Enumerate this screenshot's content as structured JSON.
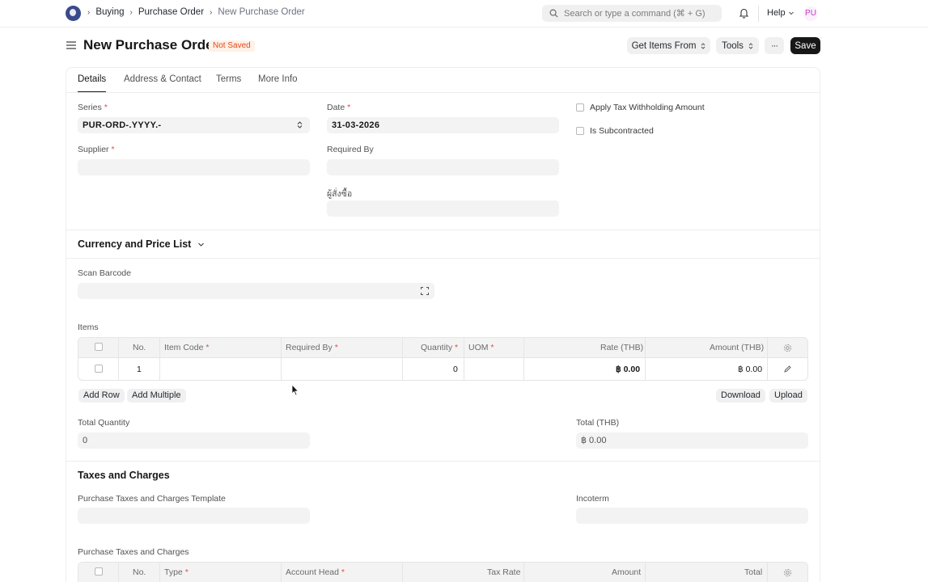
{
  "navbar": {
    "breadcrumbs": [
      "Buying",
      "Purchase Order",
      "New Purchase Order"
    ],
    "search_placeholder": "Search or type a command (⌘ + G)",
    "help_label": "Help",
    "avatar_initials": "PU"
  },
  "page": {
    "title": "New Purchase Order",
    "status": "Not Saved",
    "actions": {
      "get_items_from": "Get Items From",
      "tools": "Tools",
      "more": "···",
      "save": "Save"
    }
  },
  "tabs": [
    "Details",
    "Address & Contact",
    "Terms",
    "More Info"
  ],
  "details": {
    "series_label": "Series",
    "series_value": "PUR-ORD-.YYYY.-",
    "date_label": "Date",
    "date_value": "31-03-2026",
    "supplier_label": "Supplier",
    "required_by_label": "Required By",
    "buyer_label": "ผู้สั่งซื้อ",
    "apply_tax_withholding_label": "Apply Tax Withholding Amount",
    "is_subcontracted_label": "Is Subcontracted"
  },
  "currency_section": {
    "title": "Currency and Price List",
    "scan_barcode_label": "Scan Barcode"
  },
  "items": {
    "label": "Items",
    "headers": {
      "no": "No.",
      "item_code": "Item Code",
      "required_by": "Required By",
      "quantity": "Quantity",
      "uom": "UOM",
      "rate": "Rate (THB)",
      "amount": "Amount (THB)"
    },
    "rows": [
      {
        "no": "1",
        "item_code": "",
        "required_by": "",
        "quantity": "0",
        "uom": "",
        "rate": "฿ 0.00",
        "amount": "฿ 0.00"
      }
    ],
    "buttons": {
      "add_row": "Add Row",
      "add_multiple": "Add Multiple",
      "download": "Download",
      "upload": "Upload"
    },
    "total_quantity_label": "Total Quantity",
    "total_quantity_value": "0",
    "total_label": "Total (THB)",
    "total_value": "฿ 0.00"
  },
  "taxes_section": {
    "title": "Taxes and Charges",
    "template_label": "Purchase Taxes and Charges Template",
    "incoterm_label": "Incoterm",
    "table_label": "Purchase Taxes and Charges",
    "headers": {
      "no": "No.",
      "type": "Type",
      "account_head": "Account Head",
      "tax_rate": "Tax Rate",
      "amount": "Amount",
      "total": "Total"
    }
  },
  "colors": {
    "accent_dark": "#171717",
    "status_badge_bg": "#fff1e7",
    "status_badge_text": "#e4491d",
    "required_star": "#e24c4c",
    "avatar_text": "#c03dc0"
  },
  "icons": [
    "app-logo-icon",
    "chevron-right-icon",
    "search-icon",
    "bell-icon",
    "chevron-down-icon",
    "hamburger-icon",
    "sort-arrows-icon",
    "expand-icon",
    "gear-icon",
    "edit-icon",
    "cursor-icon"
  ]
}
